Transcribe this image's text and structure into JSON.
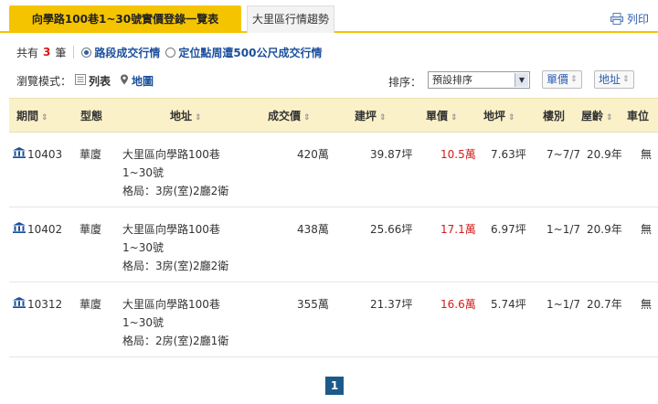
{
  "tabs": {
    "active": "向學路100巷1~30號實價登錄一覽表",
    "other": "大里區行情趨勢",
    "print_label": "列印"
  },
  "filter": {
    "count_prefix": "共有",
    "count": "3",
    "count_suffix": "筆",
    "radio_segment": "路段成交行情",
    "radio_nearby": "定位點周遭500公尺成交行情"
  },
  "view": {
    "label": "瀏覽模式：",
    "list": "列表",
    "map": "地圖"
  },
  "sort": {
    "label": "排序：",
    "selected": "預設排序",
    "unit_price_btn": "單價",
    "address_btn": "地址"
  },
  "columns": [
    "期間",
    "型態",
    "地址",
    "成交價",
    "建坪",
    "單價",
    "地坪",
    "樓別",
    "屋齡",
    "車位"
  ],
  "rows": [
    {
      "period": "10403",
      "type": "華廈",
      "addr1": "大里區向學路100巷",
      "addr2": "1~30號",
      "layout": "格局：3房(室)2廳2衛",
      "price": "420萬",
      "building_area": "39.87坪",
      "unit_price": "10.5萬",
      "land_area": "7.63坪",
      "floor": "7~7/7",
      "age": "20.9年",
      "parking": "無"
    },
    {
      "period": "10402",
      "type": "華廈",
      "addr1": "大里區向學路100巷",
      "addr2": "1~30號",
      "layout": "格局：3房(室)2廳2衛",
      "price": "438萬",
      "building_area": "25.66坪",
      "unit_price": "17.1萬",
      "land_area": "6.97坪",
      "floor": "1~1/7",
      "age": "20.9年",
      "parking": "無"
    },
    {
      "period": "10312",
      "type": "華廈",
      "addr1": "大里區向學路100巷",
      "addr2": "1~30號",
      "layout": "格局：2房(室)2廳1衛",
      "price": "355萬",
      "building_area": "21.37坪",
      "unit_price": "16.6萬",
      "land_area": "5.74坪",
      "floor": "1~1/7",
      "age": "20.7年",
      "parking": "無"
    }
  ],
  "pagination": {
    "current": "1"
  },
  "colors": {
    "accent_yellow": "#f5c400",
    "header_bg": "#fbf1c8",
    "price_red": "#d21b1b",
    "link_blue": "#1c4f9c",
    "page_blue": "#1c5a8a"
  },
  "icons": {
    "print": "printer-icon",
    "bank": "bank-icon",
    "list": "list-icon",
    "map": "map-pin-icon",
    "sort": "sort-arrows-icon"
  }
}
